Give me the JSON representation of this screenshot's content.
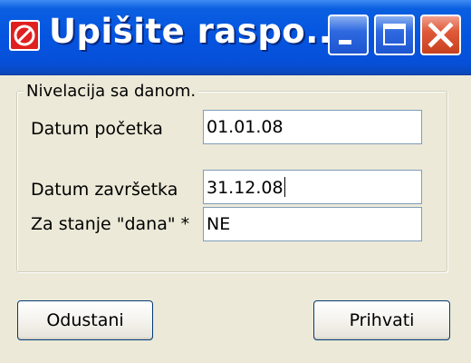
{
  "window": {
    "title": "Upišite raspo...",
    "accent": "#0554e0",
    "close_color": "#e05a3a"
  },
  "titlebar_buttons": {
    "minimize_icon": "minimize-icon",
    "maximize_icon": "maximize-icon",
    "close_icon": "close-icon"
  },
  "group": {
    "legend": "Nivelacija sa danom."
  },
  "fields": {
    "start_label": "Datum početka",
    "start_value": "01.01.08",
    "end_label": "Datum završetka",
    "end_value": "31.12.08",
    "state_label": "Za stanje \"dana\" *",
    "state_value": "NE"
  },
  "buttons": {
    "cancel_label": "Odustani",
    "accept_label": "Prihvati"
  }
}
